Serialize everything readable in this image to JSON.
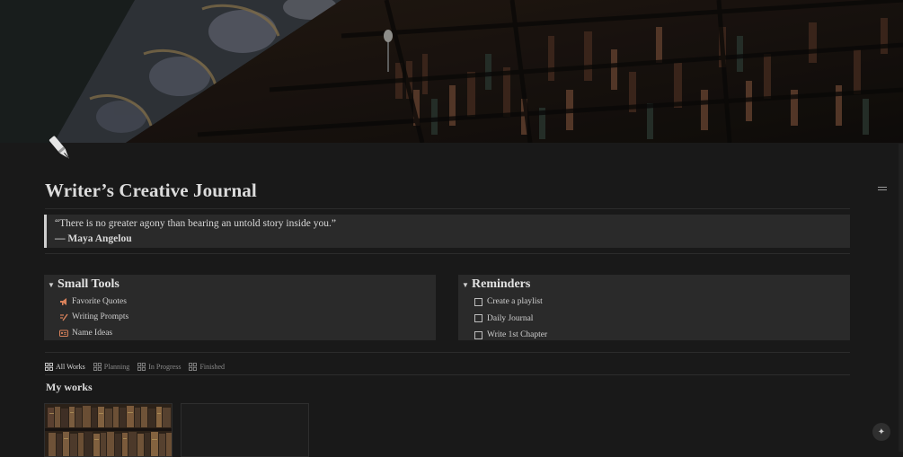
{
  "page": {
    "title": "Writer’s Creative Journal",
    "icon": "fountain-pen-icon"
  },
  "quote": {
    "text": "“There is no greater agony than bearing an untold story inside you.”",
    "author": "— Maya Angelou"
  },
  "small_tools": {
    "title": "Small Tools",
    "items": [
      {
        "label": "Favorite Quotes",
        "icon": "megaphone-icon"
      },
      {
        "label": "Writing Prompts",
        "icon": "pen-lines-icon"
      },
      {
        "label": "Name Ideas",
        "icon": "id-card-icon"
      }
    ]
  },
  "reminders": {
    "title": "Reminders",
    "items": [
      {
        "label": "Create a playlist",
        "checked": false
      },
      {
        "label": "Daily Journal",
        "checked": false
      },
      {
        "label": "Write 1st Chapter",
        "checked": false
      }
    ]
  },
  "views": {
    "tabs": [
      {
        "label": "All Works",
        "active": true
      },
      {
        "label": "Planning",
        "active": false
      },
      {
        "label": "In Progress",
        "active": false
      },
      {
        "label": "Finished",
        "active": false
      }
    ],
    "section_title": "My works"
  },
  "colors": {
    "background": "#191919",
    "block": "#2a2a2a",
    "icon_accent": "#d9825b"
  }
}
